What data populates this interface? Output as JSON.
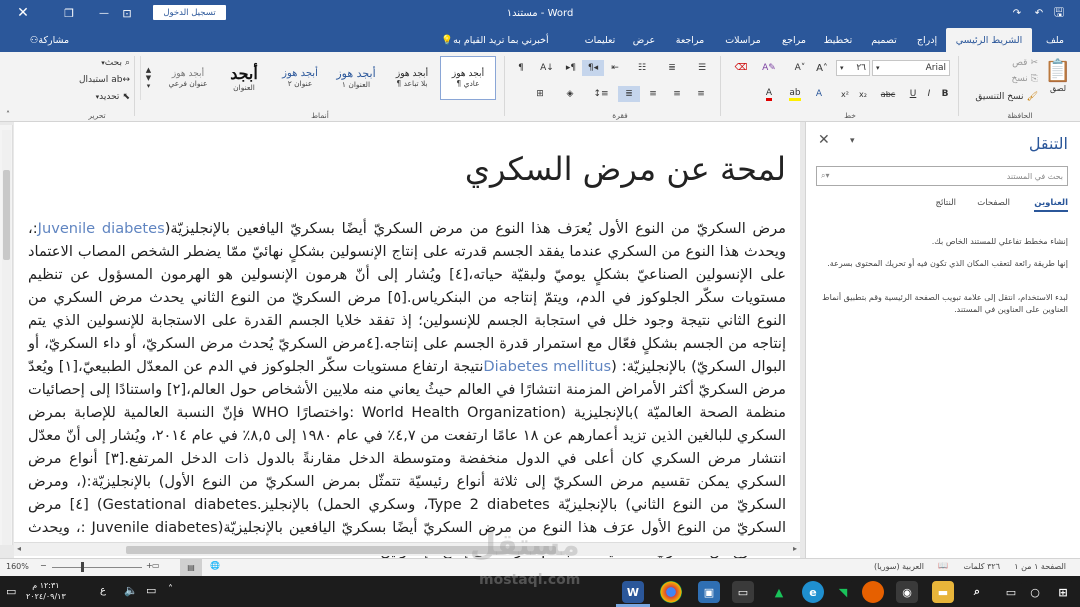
{
  "titlebar": {
    "doc_title": "مستند١ - Word",
    "signin": "تسجيل الدخول",
    "save_icon": "save-icon",
    "undo_icon": "undo-icon",
    "redo_icon": "redo-icon",
    "ribbon_display_icon": "ribbon-display-icon",
    "minimize_icon": "minimize-icon",
    "restore_icon": "restore-icon",
    "close_icon": "close-icon"
  },
  "tabs": [
    {
      "label": "ملف"
    },
    {
      "label": "الشريط الرئيسي"
    },
    {
      "label": "إدراج"
    },
    {
      "label": "تصميم"
    },
    {
      "label": "تخطيط"
    },
    {
      "label": "مراجع"
    },
    {
      "label": "مراسلات"
    },
    {
      "label": "مراجعة"
    },
    {
      "label": "عرض"
    },
    {
      "label": "تعليمات"
    }
  ],
  "tellme": "أخبرني بما تريد القيام به",
  "share": "مشاركة",
  "ribbon": {
    "paste": "لصق",
    "cut": "قص",
    "copy": "نسخ",
    "format_painter": "نسخ التنسيق",
    "clipboard_label": "الحافظة",
    "font_name": "Arial",
    "font_size": "٢٦",
    "font_label": "خط",
    "paragraph_label": "فقرة",
    "styles_label": "أنماط",
    "editing_label": "تحرير",
    "find": "بحث",
    "replace": "استبدال",
    "select": "تحديد",
    "styles": [
      {
        "sample": "أبجد هوز",
        "name": "¶ عادي"
      },
      {
        "sample": "أبجد هوز",
        "name": "¶ بلا تباعد"
      },
      {
        "sample": "أبجد هوز",
        "name": "العنوان ١"
      },
      {
        "sample": "أبجد هوز",
        "name": "عنوان ٢"
      },
      {
        "sample": "أبجد",
        "name": "العنوان"
      },
      {
        "sample": "أبجد هوز",
        "name": "عنوان فرعي"
      }
    ]
  },
  "document": {
    "title": "لمحة عن مرض السكري",
    "paragraph": [
      {
        "t": "مرض السكريّ من النوع الأول يُعرَف هذا النوع من مرض السكريّ أيضًا بسكريّ اليافعين بالإنجليزيّة(",
        "en": false
      },
      {
        "t": "Juvenile diabetes",
        "en": true
      },
      {
        "t": ":، ويحدث هذا النوع من السكري عندما يفقد الجسم قدرته على إنتاج الإنسولين بشكلٍ نهائيّ ممّا يضطر الشخص المصاب الاعتماد على الإنسولين الصناعيّ بشكلٍ يوميّ ولبقيّة حياته،[٤] ويُشار إلى أنّ هرمون الإنسولين هو الهرمون المسؤول عن تنظيم مستويات سكّر الجلوكوز في الدم، ويتمّ إنتاجه من البنكرياس.[٥] مرض السكريّ من النوع الثاني يحدث مرض السكري من النوع الثاني نتيجة وجود خلل في استجابة الجسم للإنسولين؛ إذ تفقد خلايا الجسم القدرة على الاستجابة للإنسولين الذي يتم إنتاجه من الجسم بشكلٍ فعّال مع استمرار قدرة الجسم على إنتاجه.[٤مرض السكريّ يُحدث مرض السكريّ، أو داء السكريّ، أو البوال السكريّ) بالإنجليزيّة: (",
        "en": false
      },
      {
        "t": "Diabetes mellitus",
        "en": true
      },
      {
        "t": "نتيجة ارتفاع مستويات سكّر الجلوكوز في الدم عن المعدّل الطبيعيّ،[١] ويُعدّ مرض السكريّ أكثر الأمراض المزمنة انتشارًا في العالم حيثُ يعاني منه ملايين الأشخاص حول العالم،[٢] واستنادًا إلى إحصائيات منظمة الصحة العالميّة )بالإنجليزية (World Health Organization :واختصارًا WHO فإنّ النسبة العالمية للإصابة بمرض السكري للبالغين الذين تزيد أعمارهم عن ١٨ عامًا ارتفعت من ٤,٧٪ في عام ١٩٨٠ إلى ٨,٥٪ في عام ٢٠١٤، ويُشار إلى أنّ معدّل انتشار مرض السكري كان أعلى في الدول منخفضة ومتوسطة الدخل مقارنةً بالدول ذات الدخل المرتفع.[٣] أنواع مرض السكري يمكن تقسيم مرض السكريّ إلى ثلاثة أنواع رئيسيّة تتمثّل بمرض السكريّ من النوع الأول) بالإنجليزيّة:(، ومرض السكريّ من النوع الثاني) بالإنجليزيّة Type 2 diabetes، وسكري الحمل) بالإنجليز.Gestational diabetes) [٤] مرض السكريّ من النوع الأول عرَف هذا النوع من مرض السكريّ أيضًا بسكريّ اليافعين بالإنجليزيّة(Juvenile diabetes :، ويحدث هذا النوع من السكري عندما يفقد الجسم قدرته على إنتاج الإنسولين",
        "en": false
      }
    ]
  },
  "nav": {
    "title": "التنقل",
    "search_placeholder": "بحث في المستند",
    "tabs": [
      "العناوين",
      "الصفحات",
      "النتائج"
    ],
    "hint1": "إنشاء مخطط تفاعلي للمستند الخاص بك.",
    "hint2": "إنها طريقة رائعة لتعقب المكان الذي تكون فيه أو تحريك المحتوى بسرعة.",
    "hint3": "لبدء الاستخدام، انتقل إلى علامة تبويب الصفحة الرئيسية وقم بتطبيق أنماط العناوين على العناوين في المستند."
  },
  "status": {
    "page": "الصفحة ١ من ١",
    "words": "٣٢٦ كلمات",
    "language": "العربية (سوريا)",
    "zoom": "160%"
  },
  "taskbar": {
    "time": "١٢:٣١ م",
    "date": "٢٠٢٤/٠٩/١٣",
    "lang_indicator": "ع"
  },
  "watermark": {
    "ar": "مستقل",
    "en": "mostaql.com"
  }
}
